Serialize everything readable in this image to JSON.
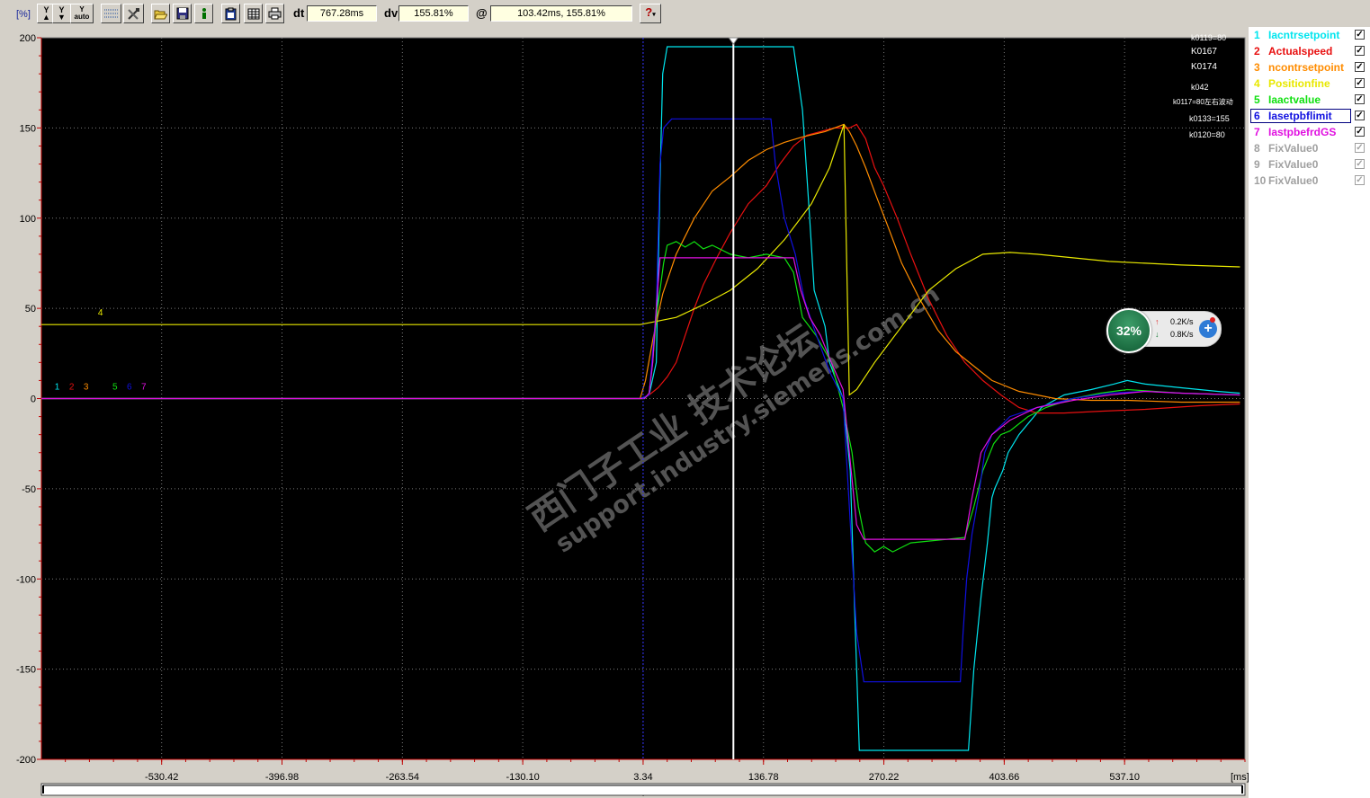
{
  "toolbar": {
    "unit_label": "[%]",
    "buttons": [
      {
        "name": "y-zoom-in-button",
        "text": "Y",
        "icon": "arrow-up-icon"
      },
      {
        "name": "y-zoom-out-button",
        "text": "Y",
        "icon": "arrow-down-icon"
      },
      {
        "name": "y-auto-button",
        "text": "Y\nauto",
        "icon": ""
      },
      {
        "name": "grid-button",
        "text": "",
        "icon": "grid-icon"
      },
      {
        "name": "tools-button",
        "text": "",
        "icon": "tools-icon"
      },
      {
        "name": "open-button",
        "text": "",
        "icon": "folder-open-icon"
      },
      {
        "name": "save-button",
        "text": "",
        "icon": "floppy-icon"
      },
      {
        "name": "info-button",
        "text": "",
        "icon": "info-icon"
      },
      {
        "name": "import-button",
        "text": "",
        "icon": "clipboard-icon"
      },
      {
        "name": "table-button",
        "text": "",
        "icon": "table-icon"
      },
      {
        "name": "print-button",
        "text": "",
        "icon": "printer-icon"
      }
    ],
    "dt_label": "dt",
    "dt_value": "767.28ms",
    "dv_label": "dv",
    "dv_value": "155.81%",
    "at_label": "@",
    "at_value": "103.42ms, 155.81%",
    "help_icon": "help-icon"
  },
  "legend": [
    {
      "num": "1",
      "name": "Iacntrsetpoint",
      "color": "#00e5ee",
      "checked": true
    },
    {
      "num": "2",
      "name": "Actualspeed",
      "color": "#e81010",
      "checked": true
    },
    {
      "num": "3",
      "name": "ncontrsetpoint",
      "color": "#ff8c00",
      "checked": true
    },
    {
      "num": "4",
      "name": "Positionfine",
      "color": "#e8e800",
      "checked": true
    },
    {
      "num": "5",
      "name": "Iaactvalue",
      "color": "#10e010",
      "checked": true
    },
    {
      "num": "6",
      "name": "Iasetpbflimit",
      "color": "#1010e0",
      "checked": true
    },
    {
      "num": "7",
      "name": "IastpbefrdGS",
      "color": "#e010e0",
      "checked": true
    },
    {
      "num": "8",
      "name": "FixValue0",
      "color": "#a0a0a0",
      "checked": false
    },
    {
      "num": "9",
      "name": "FixValue0",
      "color": "#a0a0a0",
      "checked": false
    },
    {
      "num": "10",
      "name": "FixValue0",
      "color": "#a0a0a0",
      "checked": false
    }
  ],
  "annotations": [
    "k0119=80",
    "K0167",
    "K0174",
    "k042",
    "k0117=80左右波动",
    "k0133=155",
    "k0120=80"
  ],
  "watermark": [
    "西门子工业 技术论坛",
    "support.industry.siemens.com.cn"
  ],
  "net_widget": {
    "percent": "32%",
    "up_rate": "0.2K/s",
    "down_rate": "0.8K/s"
  },
  "chart_data": {
    "type": "line",
    "y_unit": "[%]",
    "x_unit": "[ms]",
    "ylim": [
      -200,
      200
    ],
    "xlim": [
      -663.74,
      670.54
    ],
    "y_ticks": [
      200,
      150,
      100,
      50,
      0,
      -50,
      -100,
      -150,
      -200
    ],
    "x_ticks": [
      -530.42,
      -396.98,
      -263.54,
      -130.1,
      3.34,
      136.78,
      270.22,
      403.66,
      537.1
    ],
    "x_tick_labels": [
      "-530.42",
      "-396.98",
      "-263.54",
      "-130.10",
      "3.34",
      "136.78",
      "270.22",
      "403.66",
      "537.10"
    ],
    "grid": true,
    "background": "#000000",
    "cursor_x": 103.42,
    "ref_cursor_x": 3.34,
    "series_markers": [
      {
        "label": "1",
        "x": -649,
        "y": 3,
        "series": 0
      },
      {
        "label": "2",
        "x": -633,
        "y": 3,
        "series": 1
      },
      {
        "label": "3",
        "x": -617,
        "y": 3,
        "series": 2
      },
      {
        "label": "4",
        "x": -601,
        "y": 44,
        "series": 3
      },
      {
        "label": "5",
        "x": -585,
        "y": 3,
        "series": 4
      },
      {
        "label": "6",
        "x": -569,
        "y": 3,
        "series": 5
      },
      {
        "label": "7",
        "x": -553,
        "y": 3,
        "series": 6
      }
    ],
    "series": [
      {
        "name": "Iacntrsetpoint",
        "color": "#00e5ee",
        "points": [
          [
            -663.74,
            0
          ],
          [
            3,
            0
          ],
          [
            10,
            2
          ],
          [
            18,
            20
          ],
          [
            22,
            120
          ],
          [
            25,
            180
          ],
          [
            30,
            195
          ],
          [
            170,
            195
          ],
          [
            180,
            160
          ],
          [
            188,
            100
          ],
          [
            193,
            60
          ],
          [
            205,
            40
          ],
          [
            210,
            20
          ],
          [
            225,
            0
          ],
          [
            233,
            -40
          ],
          [
            238,
            -120
          ],
          [
            243,
            -195
          ],
          [
            364,
            -195
          ],
          [
            370,
            -150
          ],
          [
            378,
            -110
          ],
          [
            385,
            -80
          ],
          [
            390,
            -55
          ],
          [
            393,
            -50
          ],
          [
            402,
            -40
          ],
          [
            408,
            -30
          ],
          [
            420,
            -20
          ],
          [
            445,
            -5
          ],
          [
            470,
            2
          ],
          [
            500,
            5
          ],
          [
            525,
            8
          ],
          [
            540,
            10
          ],
          [
            560,
            8
          ],
          [
            600,
            6
          ],
          [
            640,
            4
          ],
          [
            665,
            3
          ]
        ]
      },
      {
        "name": "Actualspeed",
        "color": "#e81010",
        "points": [
          [
            -663.74,
            0
          ],
          [
            0,
            0
          ],
          [
            10,
            2
          ],
          [
            20,
            6
          ],
          [
            30,
            12
          ],
          [
            40,
            20
          ],
          [
            50,
            35
          ],
          [
            60,
            50
          ],
          [
            70,
            63
          ],
          [
            85,
            78
          ],
          [
            100,
            92
          ],
          [
            120,
            108
          ],
          [
            140,
            118
          ],
          [
            155,
            130
          ],
          [
            170,
            140
          ],
          [
            185,
            146
          ],
          [
            200,
            148
          ],
          [
            215,
            150
          ],
          [
            232,
            150
          ],
          [
            240,
            152
          ],
          [
            250,
            144
          ],
          [
            260,
            128
          ],
          [
            270,
            118
          ],
          [
            285,
            100
          ],
          [
            300,
            80
          ],
          [
            320,
            55
          ],
          [
            340,
            35
          ],
          [
            360,
            20
          ],
          [
            380,
            10
          ],
          [
            400,
            2
          ],
          [
            420,
            -5
          ],
          [
            440,
            -8
          ],
          [
            470,
            -8
          ],
          [
            510,
            -7
          ],
          [
            560,
            -6
          ],
          [
            620,
            -4
          ],
          [
            665,
            -3
          ]
        ]
      },
      {
        "name": "ncontrsetpoint",
        "color": "#ff8c00",
        "points": [
          [
            -663.74,
            0
          ],
          [
            0,
            0
          ],
          [
            6,
            10
          ],
          [
            15,
            35
          ],
          [
            25,
            58
          ],
          [
            40,
            80
          ],
          [
            60,
            100
          ],
          [
            80,
            115
          ],
          [
            100,
            123
          ],
          [
            120,
            132
          ],
          [
            140,
            138
          ],
          [
            160,
            142
          ],
          [
            180,
            145
          ],
          [
            205,
            148
          ],
          [
            226,
            152
          ],
          [
            232,
            148
          ],
          [
            240,
            140
          ],
          [
            250,
            128
          ],
          [
            262,
            112
          ],
          [
            275,
            95
          ],
          [
            290,
            75
          ],
          [
            310,
            55
          ],
          [
            330,
            38
          ],
          [
            350,
            26
          ],
          [
            370,
            18
          ],
          [
            390,
            10
          ],
          [
            420,
            4
          ],
          [
            460,
            0
          ],
          [
            500,
            -1
          ],
          [
            540,
            -1
          ],
          [
            600,
            -2
          ],
          [
            665,
            -2
          ]
        ]
      },
      {
        "name": "Positionfine",
        "color": "#e8e800",
        "points": [
          [
            -663.74,
            41
          ],
          [
            0,
            41
          ],
          [
            40,
            45
          ],
          [
            70,
            52
          ],
          [
            100,
            60
          ],
          [
            130,
            72
          ],
          [
            160,
            88
          ],
          [
            190,
            108
          ],
          [
            210,
            128
          ],
          [
            226,
            152
          ],
          [
            232,
            2
          ],
          [
            240,
            5
          ],
          [
            260,
            20
          ],
          [
            290,
            40
          ],
          [
            320,
            60
          ],
          [
            350,
            72
          ],
          [
            380,
            80
          ],
          [
            410,
            81
          ],
          [
            440,
            80
          ],
          [
            480,
            78
          ],
          [
            520,
            76
          ],
          [
            560,
            75
          ],
          [
            600,
            74
          ],
          [
            665,
            73
          ]
        ]
      },
      {
        "name": "Iaactvalue",
        "color": "#10e010",
        "points": [
          [
            -663.74,
            0
          ],
          [
            5,
            0
          ],
          [
            10,
            3
          ],
          [
            14,
            20
          ],
          [
            18,
            45
          ],
          [
            22,
            60
          ],
          [
            26,
            75
          ],
          [
            30,
            85
          ],
          [
            40,
            87
          ],
          [
            50,
            84
          ],
          [
            60,
            87
          ],
          [
            70,
            83
          ],
          [
            80,
            85
          ],
          [
            100,
            80
          ],
          [
            120,
            78
          ],
          [
            140,
            80
          ],
          [
            160,
            78
          ],
          [
            170,
            70
          ],
          [
            180,
            45
          ],
          [
            195,
            35
          ],
          [
            212,
            20
          ],
          [
            225,
            -5
          ],
          [
            235,
            -30
          ],
          [
            242,
            -60
          ],
          [
            250,
            -80
          ],
          [
            260,
            -85
          ],
          [
            270,
            -82
          ],
          [
            280,
            -85
          ],
          [
            300,
            -80
          ],
          [
            340,
            -78
          ],
          [
            360,
            -77
          ],
          [
            370,
            -60
          ],
          [
            380,
            -40
          ],
          [
            392,
            -25
          ],
          [
            400,
            -20
          ],
          [
            410,
            -18
          ],
          [
            430,
            -10
          ],
          [
            450,
            -5
          ],
          [
            480,
            0
          ],
          [
            510,
            3
          ],
          [
            540,
            5
          ],
          [
            600,
            3
          ],
          [
            665,
            2
          ]
        ]
      },
      {
        "name": "Iasetpbflimit",
        "color": "#1010e0",
        "points": [
          [
            -663.74,
            0
          ],
          [
            0,
            0
          ],
          [
            10,
            2
          ],
          [
            18,
            50
          ],
          [
            22,
            130
          ],
          [
            26,
            150
          ],
          [
            35,
            155
          ],
          [
            145,
            155
          ],
          [
            150,
            130
          ],
          [
            160,
            100
          ],
          [
            172,
            80
          ],
          [
            182,
            55
          ],
          [
            192,
            40
          ],
          [
            210,
            15
          ],
          [
            225,
            0
          ],
          [
            232,
            -60
          ],
          [
            240,
            -130
          ],
          [
            248,
            -157
          ],
          [
            355,
            -157
          ],
          [
            358,
            -130
          ],
          [
            362,
            -100
          ],
          [
            368,
            -75
          ],
          [
            375,
            -55
          ],
          [
            382,
            -30
          ],
          [
            390,
            -20
          ],
          [
            410,
            -10
          ],
          [
            440,
            -5
          ],
          [
            480,
            0
          ],
          [
            520,
            3
          ],
          [
            560,
            4
          ],
          [
            600,
            3
          ],
          [
            665,
            2
          ]
        ]
      },
      {
        "name": "IastpbefrdGS",
        "color": "#e010e0",
        "points": [
          [
            -663.74,
            0
          ],
          [
            5,
            0
          ],
          [
            10,
            3
          ],
          [
            14,
            20
          ],
          [
            18,
            50
          ],
          [
            22,
            78
          ],
          [
            170,
            78
          ],
          [
            178,
            60
          ],
          [
            188,
            45
          ],
          [
            200,
            35
          ],
          [
            212,
            20
          ],
          [
            225,
            5
          ],
          [
            232,
            -30
          ],
          [
            240,
            -70
          ],
          [
            248,
            -78
          ],
          [
            360,
            -78
          ],
          [
            368,
            -55
          ],
          [
            378,
            -30
          ],
          [
            390,
            -20
          ],
          [
            410,
            -12
          ],
          [
            440,
            -5
          ],
          [
            480,
            -1
          ],
          [
            520,
            2
          ],
          [
            560,
            4
          ],
          [
            600,
            3
          ],
          [
            665,
            2
          ]
        ]
      }
    ]
  }
}
